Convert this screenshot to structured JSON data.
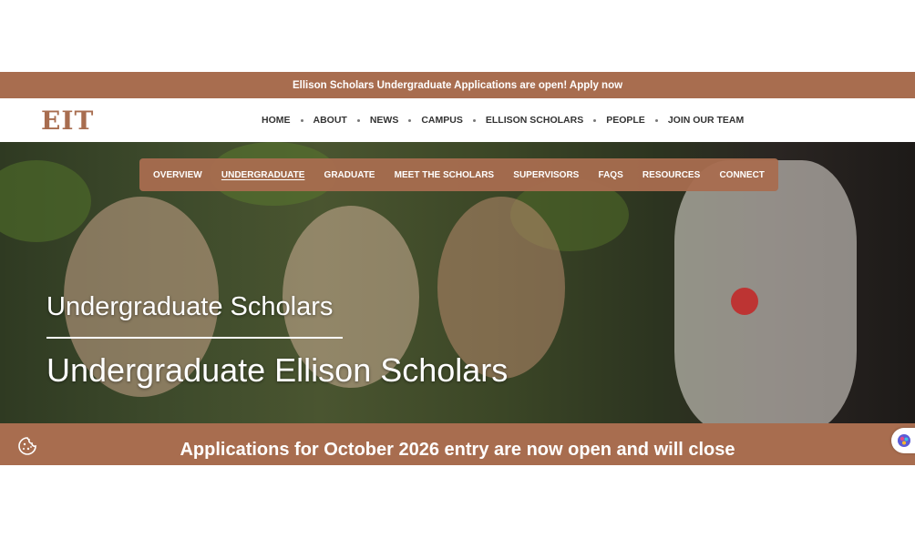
{
  "announcement": {
    "text": "Ellison Scholars Undergraduate Applications are open! Apply now"
  },
  "header": {
    "logo": "EIT",
    "nav": [
      "HOME",
      "ABOUT",
      "NEWS",
      "CAMPUS",
      "ELLISON SCHOLARS",
      "PEOPLE",
      "JOIN OUR TEAM"
    ]
  },
  "subnav": {
    "items": [
      "OVERVIEW",
      "UNDERGRADUATE",
      "GRADUATE",
      "MEET THE SCHOLARS",
      "SUPERVISORS",
      "FAQS",
      "RESOURCES",
      "CONNECT"
    ],
    "active": "UNDERGRADUATE"
  },
  "hero": {
    "subtitle": "Undergraduate Scholars",
    "title": "Undergraduate Ellison Scholars",
    "image": "photo of laughing students in formal attire"
  },
  "banner": {
    "text": "Applications for October 2026 entry are now open and will close"
  },
  "icons": {
    "cookie": "cookie-icon",
    "assistant": "accessibility-assistant-icon"
  },
  "colors": {
    "brand": "#a86d4f",
    "text": "#333333"
  }
}
